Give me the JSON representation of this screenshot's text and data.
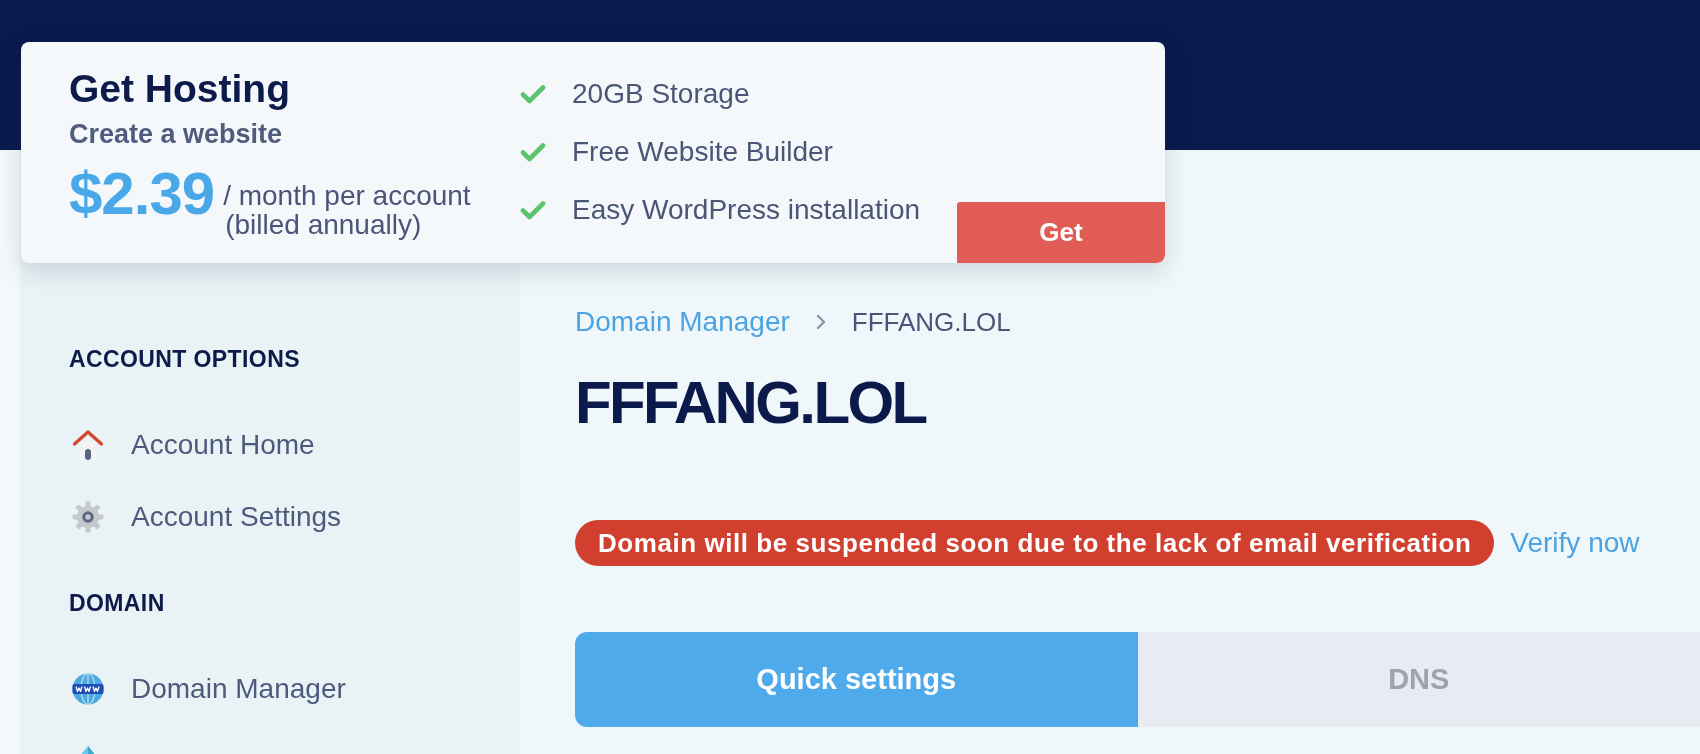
{
  "promo": {
    "title": "Get Hosting",
    "subtitle": "Create a website",
    "price": "$2.39",
    "price_period": "/ month per account",
    "price_note": "(billed annually)",
    "features": [
      "20GB Storage",
      "Free Website Builder",
      "Easy WordPress installation"
    ],
    "button": "Get"
  },
  "sidebar": {
    "sections": [
      {
        "heading": "ACCOUNT OPTIONS",
        "items": [
          {
            "kind": "link",
            "label": "Account Home"
          },
          {
            "kind": "link",
            "label": "Account Settings"
          }
        ]
      },
      {
        "heading": "DOMAIN",
        "items": [
          {
            "kind": "link",
            "label": "Domain Manager"
          },
          {
            "kind": "icon_only"
          }
        ]
      }
    ]
  },
  "main": {
    "breadcrumb": [
      {
        "label": "Domain Manager",
        "kind": "link"
      },
      {
        "label": "FFFANG.LOL",
        "kind": "current"
      }
    ],
    "title": "FFFANG.LOL",
    "alert": {
      "message": "Domain will be suspended soon due to the lack of email verification",
      "action": "Verify now"
    },
    "tabs": [
      {
        "label": "Quick settings",
        "selected": true
      },
      {
        "label": "DNS",
        "selected": false
      }
    ]
  }
}
